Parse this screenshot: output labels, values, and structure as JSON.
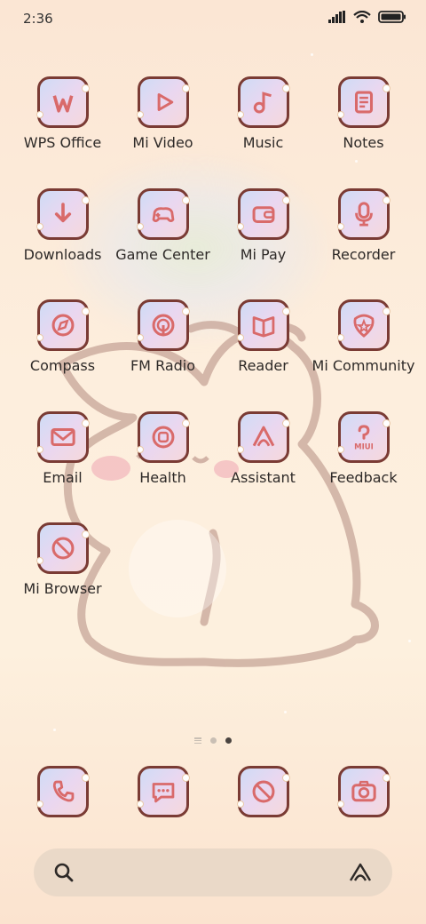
{
  "status_bar": {
    "time": "2:36"
  },
  "apps": [
    {
      "label": "WPS Office",
      "icon": "wps-icon"
    },
    {
      "label": "Mi Video",
      "icon": "play-icon"
    },
    {
      "label": "Music",
      "icon": "music-note-icon"
    },
    {
      "label": "Notes",
      "icon": "notes-icon"
    },
    {
      "label": "Downloads",
      "icon": "download-arrow-icon"
    },
    {
      "label": "Game Center",
      "icon": "gamepad-icon"
    },
    {
      "label": "Mi Pay",
      "icon": "wallet-icon"
    },
    {
      "label": "Recorder",
      "icon": "microphone-icon"
    },
    {
      "label": "Compass",
      "icon": "compass-icon"
    },
    {
      "label": "FM Radio",
      "icon": "radio-icon"
    },
    {
      "label": "Reader",
      "icon": "book-icon"
    },
    {
      "label": "Mi Community",
      "icon": "community-badge-icon"
    },
    {
      "label": "Email",
      "icon": "envelope-icon"
    },
    {
      "label": "Health",
      "icon": "health-icon"
    },
    {
      "label": "Assistant",
      "icon": "assistant-icon"
    },
    {
      "label": "Feedback",
      "icon": "feedback-icon"
    },
    {
      "label": "Mi Browser",
      "icon": "browser-globe-icon"
    }
  ],
  "dock": [
    {
      "icon": "phone-icon"
    },
    {
      "icon": "messages-icon"
    },
    {
      "icon": "browser-globe-icon"
    },
    {
      "icon": "camera-icon"
    }
  ],
  "page_indicator": {
    "pages": 2,
    "active": 2
  },
  "search_bar": {
    "left_icon": "search-icon",
    "right_icon": "assistant-icon"
  },
  "colors": {
    "icon_stroke": "#d96a6a",
    "icon_border": "#7a3b34",
    "label": "#2e2a28"
  }
}
